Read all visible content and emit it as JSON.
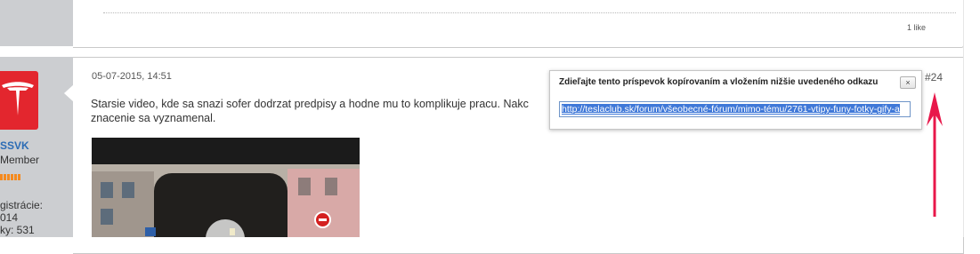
{
  "previous_post": {
    "likes": "1 like"
  },
  "author": {
    "username": "SSVK",
    "role": "Member",
    "registration_label": "gistrácie:",
    "registration_year": "014",
    "posts_label": "ky:  531",
    "rank_color": "#f58a1f",
    "avatar_color": "#e3262e"
  },
  "post": {
    "date": "05-07-2015, 14:51",
    "number": "#24",
    "text_line1": "Starsie video, kde sa snazi sofer dodrzat predpisy a hodne mu to komplikuje pracu. Nakc",
    "text_line2": "znacenie sa vyznamenal."
  },
  "share_popup": {
    "title": "Zdieľajte tento príspevok kopírovaním a vložením nižšie uvedeného odkazu",
    "close_label": "×",
    "link": "http://teslaclub.sk/forum/všeobecné-fórum/mimo-tému/2761-vtipy-funy-fotky-gify-a"
  },
  "annotation": {
    "arrow_color": "#e8174a"
  },
  "icons": [
    "tesla-logo-icon",
    "close-icon",
    "play-icon",
    "arrow-up-icon"
  ]
}
